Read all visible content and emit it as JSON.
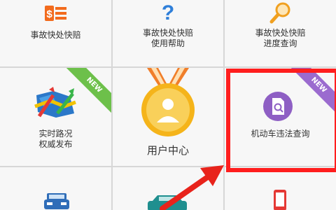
{
  "tiles": {
    "quick_claim": {
      "label": "事故快处快赔",
      "icon": "money-list-icon"
    },
    "help": {
      "label": "事故快处快赔\n使用帮助",
      "icon": "question-icon"
    },
    "progress": {
      "label": "事故快处快赔\n进度查询",
      "icon": "magnifier-icon"
    },
    "traffic": {
      "label": "实时路况\n权威发布",
      "icon": "road-map-icon",
      "badge": "NEW"
    },
    "user_center": {
      "label": "用户中心",
      "icon": "medal-user-icon"
    },
    "violation": {
      "label": "机动车违法查询",
      "icon": "document-search-icon",
      "badge": "NEW"
    }
  },
  "colors": {
    "green_badge": "#6dc04a",
    "purple_badge": "#9b6bcf",
    "highlight": "#ff1e1e",
    "arrow": "#e8231b",
    "icon_orange": "#f08a24",
    "icon_blue": "#2f7fd9",
    "medal_gold": "#f5b41a"
  }
}
